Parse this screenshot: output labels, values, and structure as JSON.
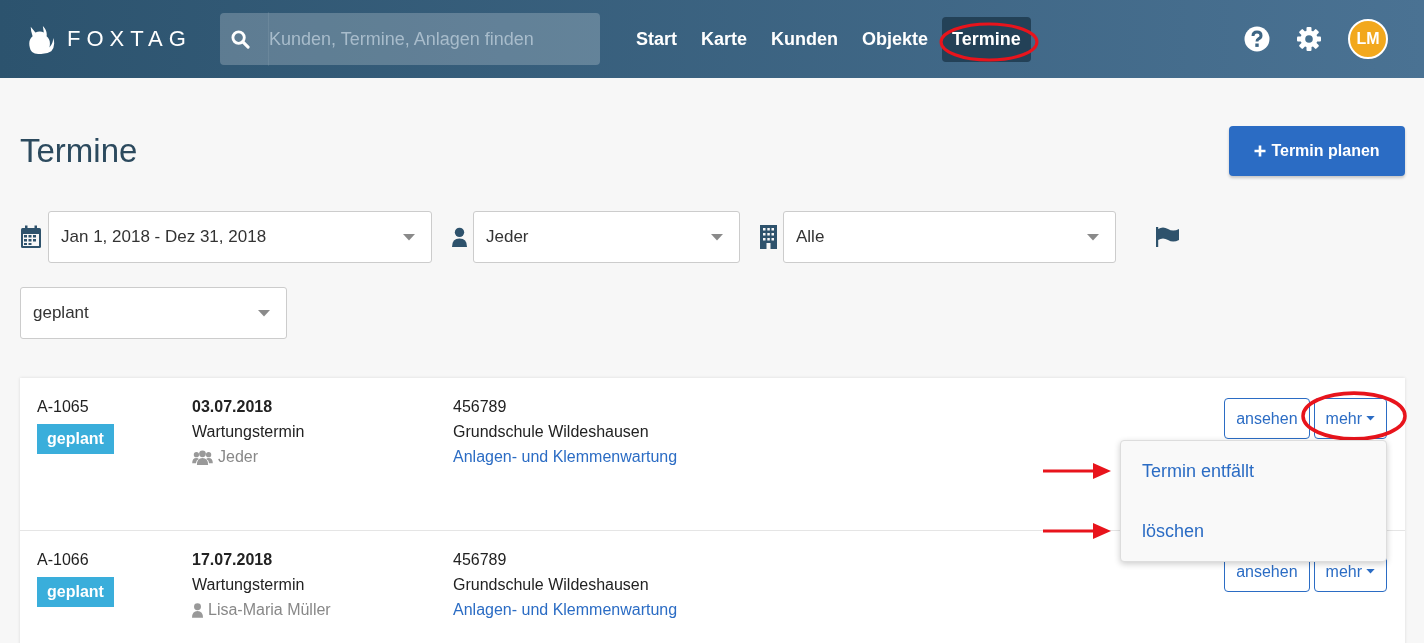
{
  "header": {
    "logo": "FOXTAG",
    "search": {
      "placeholder": "Kunden, Termine, Anlagen finden"
    },
    "nav": [
      {
        "label": "Start",
        "selected": false
      },
      {
        "label": "Karte",
        "selected": false
      },
      {
        "label": "Kunden",
        "selected": false
      },
      {
        "label": "Objekte",
        "selected": false
      },
      {
        "label": "Termine",
        "selected": true
      }
    ],
    "avatar": "LM"
  },
  "page": {
    "title": "Termine",
    "new_button": "Termin planen"
  },
  "filters": [
    {
      "kind": "calendar",
      "value": "Jan 1, 2018 - Dez 31, 2018"
    },
    {
      "kind": "person",
      "value": "Jeder"
    },
    {
      "kind": "building",
      "value": "Alle"
    },
    {
      "kind": "flag"
    },
    {
      "kind": "plain",
      "value": "geplant"
    }
  ],
  "appointments": [
    {
      "id": "A-1065",
      "status": "geplant",
      "date": "03.07.2018",
      "type": "Wartungstermin",
      "kind": "group",
      "assignee": "Jeder",
      "number": "456789",
      "place": "Grundschule Wildeshausen",
      "link": "Anlagen- und Klemmenwartung",
      "view_button": "ansehen",
      "more_button": "mehr",
      "menu": {
        "expanded": true,
        "items": [
          "Termin entfällt",
          "löschen"
        ]
      }
    },
    {
      "id": "A-1066",
      "status": "geplant",
      "date": "17.07.2018",
      "type": "Wartungstermin",
      "kind": "person",
      "assignee": "Lisa-Maria Müller",
      "number": "456789",
      "place": "Grundschule Wildeshausen",
      "link": "Anlagen- und Klemmenwartung",
      "view_button": "ansehen",
      "more_button": "mehr",
      "menu": {
        "expanded": false
      }
    }
  ]
}
